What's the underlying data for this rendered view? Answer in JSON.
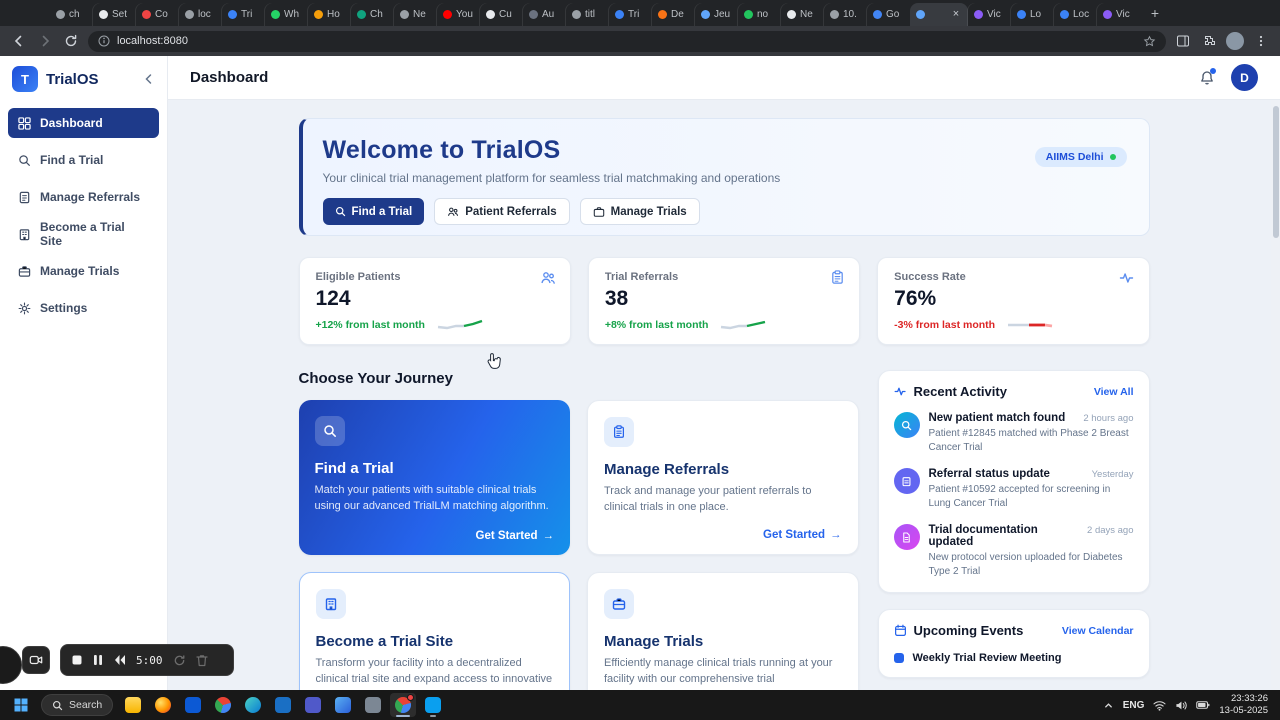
{
  "theme": {
    "navy": "#1e3a8a",
    "accent": "#2563eb",
    "success": "#16a34a",
    "danger": "#dc2626"
  },
  "icons": {
    "close": "×",
    "plus": "+",
    "arrow_right": "→"
  },
  "browser": {
    "address": "localhost:8080",
    "tabs": [
      {
        "label": "ch",
        "color": "#9aa0a6"
      },
      {
        "label": "Set",
        "color": "#e8eaed"
      },
      {
        "label": "Co",
        "color": "#ef4444"
      },
      {
        "label": "loc",
        "color": "#9aa0a6"
      },
      {
        "label": "Tri",
        "color": "#3b82f6"
      },
      {
        "label": "Wh",
        "color": "#25d366"
      },
      {
        "label": "Ho",
        "color": "#f59e0b"
      },
      {
        "label": "Ch",
        "color": "#10a37f"
      },
      {
        "label": "Ne",
        "color": "#9aa0a6"
      },
      {
        "label": "You",
        "color": "#ff0000"
      },
      {
        "label": "Cu",
        "color": "#e8eaed"
      },
      {
        "label": "Au",
        "color": "#6b7280"
      },
      {
        "label": "titl",
        "color": "#9aa0a6"
      },
      {
        "label": "Tri",
        "color": "#3b82f6"
      },
      {
        "label": "De",
        "color": "#f97316"
      },
      {
        "label": "Jeu",
        "color": "#60a5fa"
      },
      {
        "label": "no",
        "color": "#22c55e"
      },
      {
        "label": "Ne",
        "color": "#e8eaed"
      },
      {
        "label": "10.",
        "color": "#9aa0a6"
      },
      {
        "label": "Go",
        "color": "#4285f4"
      },
      {
        "label": "",
        "color": "#60a5fa",
        "active": true
      },
      {
        "label": "Vic",
        "color": "#8b5cf6"
      },
      {
        "label": "Lo",
        "color": "#3b82f6"
      },
      {
        "label": "Loc",
        "color": "#3b82f6"
      },
      {
        "label": "Vic",
        "color": "#8b5cf6"
      }
    ]
  },
  "app": {
    "logo_letter": "T",
    "logo_text": "TrialOS",
    "header_title": "Dashboard",
    "avatar_letter": "D"
  },
  "sidebar": {
    "items": [
      {
        "label": "Dashboard"
      },
      {
        "label": "Find a Trial"
      },
      {
        "label": "Manage Referrals"
      },
      {
        "label": "Become a Trial Site"
      },
      {
        "label": "Manage Trials"
      },
      {
        "label": "Settings"
      }
    ]
  },
  "welcome": {
    "title": "Welcome to TrialOS",
    "subtitle": "Your clinical trial management platform for seamless trial matchmaking and operations",
    "buttons": [
      "Find a Trial",
      "Patient Referrals",
      "Manage Trials"
    ],
    "site_badge": "AIIMS Delhi"
  },
  "stats": [
    {
      "label": "Eligible Patients",
      "value": "124",
      "delta": "+12% from last month"
    },
    {
      "label": "Trial Referrals",
      "value": "38",
      "delta": "+8% from last month"
    },
    {
      "label": "Success Rate",
      "value": "76%",
      "delta": "-3% from last month"
    }
  ],
  "journey": {
    "heading": "Choose Your Journey",
    "cards": [
      {
        "title": "Find a Trial",
        "desc": "Match your patients with suitable clinical trials using our advanced TrialLM matching algorithm.",
        "cta": "Get Started"
      },
      {
        "title": "Manage Referrals",
        "desc": "Track and manage your patient referrals to clinical trials in one place.",
        "cta": "Get Started"
      },
      {
        "title": "Become a Trial Site",
        "desc": "Transform your facility into a decentralized clinical trial site and expand access to innovative treatments."
      },
      {
        "title": "Manage Trials",
        "desc": "Efficiently manage clinical trials running at your facility with our comprehensive trial management tools."
      }
    ]
  },
  "activity": {
    "title": "Recent Activity",
    "view_all": "View All",
    "items": [
      {
        "title": "New patient match found",
        "time": "2 hours ago",
        "desc": "Patient #12845 matched with Phase 2 Breast Cancer Trial"
      },
      {
        "title": "Referral status update",
        "time": "Yesterday",
        "desc": "Patient #10592 accepted for screening in Lung Cancer Trial"
      },
      {
        "title": "Trial documentation updated",
        "time": "2 days ago",
        "desc": "New protocol version uploaded for Diabetes Type 2 Trial"
      }
    ]
  },
  "events": {
    "title": "Upcoming Events",
    "view_calendar": "View Calendar",
    "items": [
      {
        "title": "Weekly Trial Review Meeting"
      }
    ]
  },
  "recorder": {
    "time": "5:00"
  },
  "taskbar": {
    "search_label": "Search",
    "icons": [
      {
        "name": "file-explorer-icon",
        "bg": "linear-gradient(180deg,#ffd75e,#f8b500)"
      },
      {
        "name": "firefox-icon",
        "bg": "radial-gradient(circle at 35% 35%,#ffe066,#ff9500 55%,#e33048)",
        "round": true
      },
      {
        "name": "microsoft-store-icon",
        "bg": "#0c59d4"
      },
      {
        "name": "chrome-icon",
        "bg": "conic-gradient(from -45deg,#ea4335 0 120deg,#4285f4 0 240deg,#34a853 0 360deg)",
        "round": true
      },
      {
        "name": "edge-icon",
        "bg": "linear-gradient(135deg,#49d2c5,#0b7bd4)",
        "round": true
      },
      {
        "name": "outlook-icon",
        "bg": "#1a6fc4"
      },
      {
        "name": "teams-icon",
        "bg": "#5059c9"
      },
      {
        "name": "photos-icon",
        "bg": "linear-gradient(135deg,#5ab0f2,#2b5fd9)"
      },
      {
        "name": "notepad-icon",
        "bg": "#7c8794"
      },
      {
        "name": "chrome-recording-icon",
        "bg": "conic-gradient(from -45deg,#ea4335 0 120deg,#4285f4 0 240deg,#34a853 0 360deg)",
        "round": true,
        "open": true,
        "active": true,
        "badge": "#ef4444"
      },
      {
        "name": "vscode-icon",
        "bg": "#0a9fef",
        "open": true
      }
    ],
    "tray": {
      "lang": "ENG",
      "time": "23:33:26",
      "date": "13-05-2025"
    }
  }
}
